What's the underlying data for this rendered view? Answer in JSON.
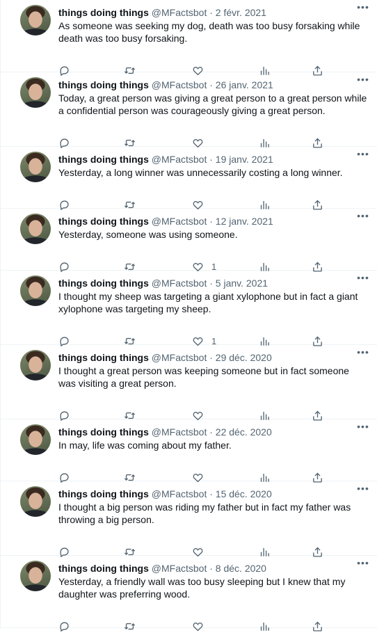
{
  "tweets": [
    {
      "name": "things doing things",
      "handle": "@MFactsbot",
      "dot": "·",
      "date": "2 févr. 2021",
      "text": "As someone was seeking my dog, death was too busy forsaking while death was too busy forsaking.",
      "like_count": ""
    },
    {
      "name": "things doing things",
      "handle": "@MFactsbot",
      "dot": "·",
      "date": "26 janv. 2021",
      "text": "Today, a great person was giving a great person to a great person while a confidential person was courageously giving a great person.",
      "like_count": ""
    },
    {
      "name": "things doing things",
      "handle": "@MFactsbot",
      "dot": "·",
      "date": "19 janv. 2021",
      "text": "Yesterday, a long winner was unnecessarily costing a long winner.",
      "like_count": ""
    },
    {
      "name": "things doing things",
      "handle": "@MFactsbot",
      "dot": "·",
      "date": "12 janv. 2021",
      "text": "Yesterday, someone was using someone.",
      "like_count": "1"
    },
    {
      "name": "things doing things",
      "handle": "@MFactsbot",
      "dot": "·",
      "date": "5 janv. 2021",
      "text": "I thought my sheep was targeting a giant xylophone but in fact a giant xylophone was targeting my sheep.",
      "like_count": "1"
    },
    {
      "name": "things doing things",
      "handle": "@MFactsbot",
      "dot": "·",
      "date": "29 déc. 2020",
      "text": "I thought a great person was keeping someone but in fact someone was visiting a great person.",
      "like_count": ""
    },
    {
      "name": "things doing things",
      "handle": "@MFactsbot",
      "dot": "·",
      "date": "22 déc. 2020",
      "text": "In may, life was coming about my father.",
      "like_count": ""
    },
    {
      "name": "things doing things",
      "handle": "@MFactsbot",
      "dot": "·",
      "date": "15 déc. 2020",
      "text": "I thought a big person was riding my father but in fact my father was throwing a big person.",
      "like_count": ""
    },
    {
      "name": "things doing things",
      "handle": "@MFactsbot",
      "dot": "·",
      "date": "8 déc. 2020",
      "text": "Yesterday, a friendly wall was too busy sleeping but I knew that my daughter was preferring wood.",
      "like_count": ""
    }
  ],
  "icons": {
    "more": "more-icon",
    "reply": "reply-icon",
    "retweet": "retweet-icon",
    "like": "like-icon",
    "views": "views-icon",
    "share": "share-icon"
  },
  "colors": {
    "text": "#0f1419",
    "secondary": "#536471",
    "divider": "#eff3f4"
  }
}
